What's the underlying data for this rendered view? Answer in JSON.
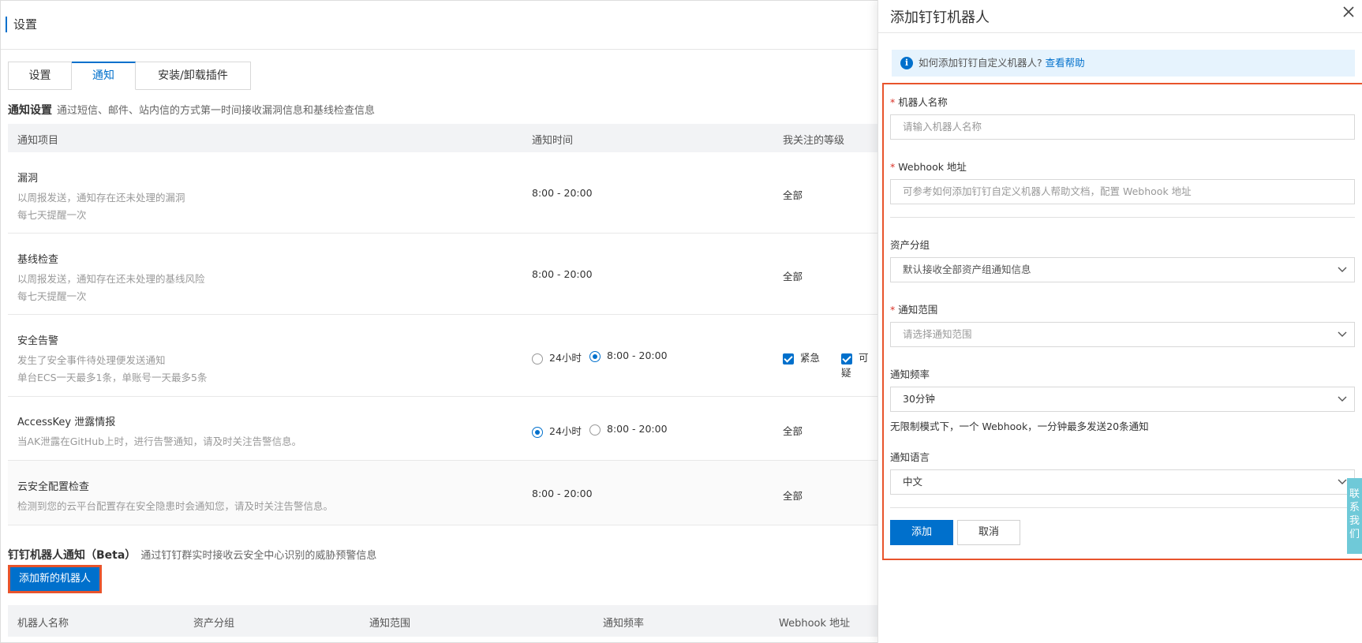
{
  "page": {
    "title": "设置",
    "tabs": [
      "设置",
      "通知",
      "安装/卸载插件"
    ]
  },
  "notify": {
    "title": "通知设置",
    "desc": "通过短信、邮件、站内信的方式第一时间接收漏洞信息和基线检查信息",
    "headers": {
      "item": "通知项目",
      "time": "通知时间",
      "level": "我关注的等级"
    },
    "rows": [
      {
        "name": "漏洞",
        "desc1": "以周报发送，通知存在还未处理的漏洞",
        "desc2": "每七天提醒一次",
        "time": "8:00 - 20:00",
        "level": "全部"
      },
      {
        "name": "基线检查",
        "desc1": "以周报发送，通知存在还未处理的基线风险",
        "desc2": "每七天提醒一次",
        "time": "8:00 - 20:00",
        "level": "全部"
      },
      {
        "name": "安全告警",
        "desc1": "发生了安全事件待处理便发送通知",
        "desc2": "单台ECS一天最多1条，单账号一天最多5条",
        "time_options": [
          "24小时",
          "8:00 - 20:00"
        ],
        "time_selected": 1,
        "levels": [
          "紧急",
          "可疑"
        ]
      },
      {
        "name": "AccessKey 泄露情报",
        "desc1": "当AK泄露在GitHub上时，进行告警通知，请及时关注告警信息。",
        "time_options": [
          "24小时",
          "8:00 - 20:00"
        ],
        "time_selected": 0,
        "level": "全部"
      },
      {
        "name": "云安全配置检查",
        "desc1": "检测到您的云平台配置存在安全隐患时会通知您，请及时关注告警信息。",
        "time": "8:00 - 20:00",
        "level": "全部"
      }
    ]
  },
  "robot": {
    "title": "钉钉机器人通知（Beta）",
    "desc": "通过钉钉群实时接收云安全中心识别的威胁预警信息",
    "add_button": "添加新的机器人",
    "headers": [
      "机器人名称",
      "资产分组",
      "通知范围",
      "通知频率",
      "Webhook 地址"
    ]
  },
  "drawer": {
    "title": "添加钉钉机器人",
    "info_text": "如何添加钉钉自定义机器人?",
    "info_link": "查看帮助",
    "name_label": "机器人名称",
    "name_placeholder": "请输入机器人名称",
    "webhook_label": "Webhook 地址",
    "webhook_placeholder": "可参考如何添加钉钉自定义机器人帮助文档，配置 Webhook 地址",
    "group_label": "资产分组",
    "group_value": "默认接收全部资产组通知信息",
    "scope_label": "通知范围",
    "scope_placeholder": "请选择通知范围",
    "freq_label": "通知频率",
    "freq_value": "30分钟",
    "freq_hint": "无限制模式下，一个 Webhook，一分钟最多发送20条通知",
    "lang_label": "通知语言",
    "lang_value": "中文",
    "add_button": "添加",
    "cancel_button": "取消"
  },
  "side_tab": "联系我们",
  "colors": {
    "accent": "#0070cc",
    "highlight": "#e8542c",
    "info_bg": "#e6f3fd"
  }
}
